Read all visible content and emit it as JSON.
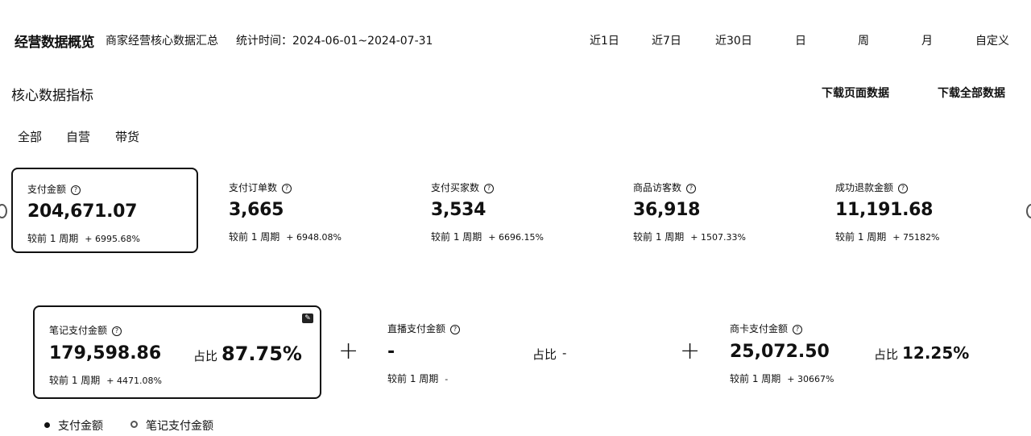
{
  "header": {
    "title": "经营数据概览",
    "subtitle": "商家经营核心数据汇总",
    "date_range": "统计时间：2024-06-01~2024-07-31",
    "range_tabs": [
      "近1日",
      "近7日",
      "近30日",
      "日",
      "周",
      "月",
      "自定义"
    ]
  },
  "section": {
    "title": "核心数据指标",
    "download_page": "下载页面数据",
    "download_all": "下载全部数据"
  },
  "filters": [
    "全部",
    "自营",
    "带货"
  ],
  "metrics": [
    {
      "label": "支付金额",
      "value": "204,671.07",
      "compare": "较前 1 周期",
      "change": "+ 6995.68%"
    },
    {
      "label": "支付订单数",
      "value": "3,665",
      "compare": "较前 1 周期",
      "change": "+ 6948.08%"
    },
    {
      "label": "支付买家数",
      "value": "3,534",
      "compare": "较前 1 周期",
      "change": "+ 6696.15%"
    },
    {
      "label": "商品访客数",
      "value": "36,918",
      "compare": "较前 1 周期",
      "change": "+ 1507.33%"
    },
    {
      "label": "成功退款金额",
      "value": "11,191.68",
      "compare": "较前 1 周期",
      "change": "+ 75182%"
    }
  ],
  "breakdown": [
    {
      "label": "笔记支付金额",
      "value": "179,598.86",
      "ratio_label": "占比",
      "ratio": "87.75%",
      "compare": "较前 1 周期",
      "change": "+ 4471.08%"
    },
    {
      "label": "直播支付金额",
      "value": "-",
      "ratio_label": "占比",
      "ratio": "-",
      "compare": "较前 1 周期",
      "change": "-"
    },
    {
      "label": "商卡支付金额",
      "value": "25,072.50",
      "ratio_label": "占比",
      "ratio": "12.25%",
      "compare": "较前 1 周期",
      "change": "+ 30667%"
    }
  ],
  "plus_symbol": "+",
  "legend": [
    "支付金额",
    "笔记支付金额"
  ],
  "icons": {
    "help": "question-circle-icon",
    "corner": "edit-icon"
  }
}
